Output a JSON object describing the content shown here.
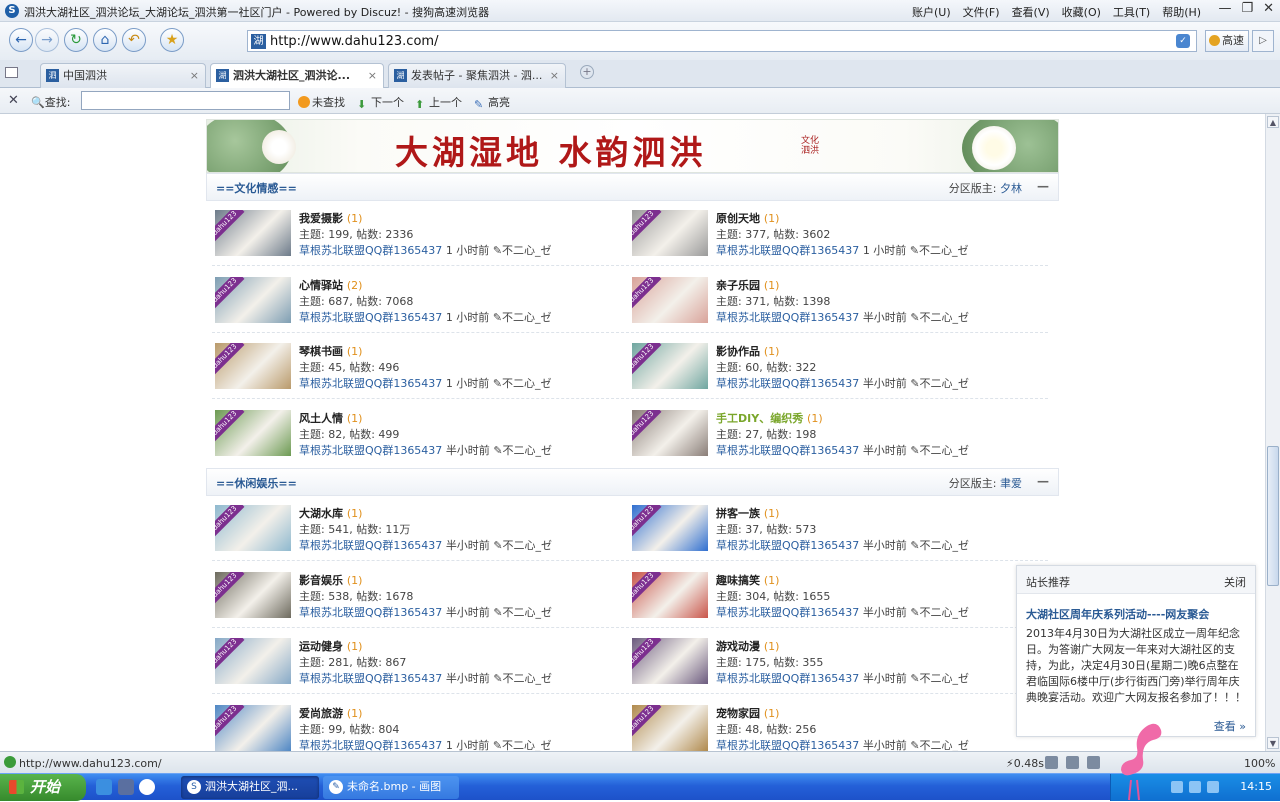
{
  "window": {
    "title": "泗洪大湖社区_泗洪论坛_大湖论坛_泗洪第一社区门户 - Powered by Discuz! - 搜狗高速浏览器",
    "menus": [
      "账户(U)",
      "文件(F)",
      "查看(V)",
      "收藏(O)",
      "工具(T)",
      "帮助(H)"
    ],
    "min": "—",
    "max": "❐",
    "close": "✕"
  },
  "navbar": {
    "url": "http://www.dahu123.com/",
    "speed_label": "高速",
    "back_icon": "arrow-left",
    "forward_icon": "arrow-right",
    "refresh_icon": "refresh",
    "home_icon": "home",
    "undo_icon": "undo",
    "favorite_icon": "star"
  },
  "tabs": [
    {
      "label": "中国泗洪",
      "active": false
    },
    {
      "label": "泗洪大湖社区_泗洪论...",
      "active": true
    },
    {
      "label": "发表帖子 - 聚焦泗洪 - 泗...",
      "active": false
    }
  ],
  "findbar": {
    "close": "✕",
    "label": "查找:",
    "value": "",
    "not_found": "未查找",
    "next": "下一个",
    "prev": "上一个",
    "highlight": "高亮"
  },
  "banner": {
    "text": "大湖湿地  水韵泗洪",
    "seal": "文化泗洪"
  },
  "categories": [
    {
      "name": "==文化情感==",
      "moderator_label": "分区版主:",
      "moderator": "夕林",
      "collapse": "—",
      "forums": [
        {
          "name": "我爱摄影",
          "today": "(1)",
          "stats": "主题: 199, 帖数: 2336",
          "last_title": "草根苏北联盟QQ群1365437",
          "last_time": "1 小时前",
          "last_user": "✎不二心_ゼ",
          "color": "#6d7b8a"
        },
        {
          "name": "原创天地",
          "today": "(1)",
          "stats": "主题: 377, 帖数: 3602",
          "last_title": "草根苏北联盟QQ群1365437",
          "last_time": "1 小时前",
          "last_user": "✎不二心_ゼ",
          "color": "#9a9a9a"
        },
        {
          "name": "心情驿站",
          "today": "(2)",
          "stats": "主题: 687, 帖数: 7068",
          "last_title": "草根苏北联盟QQ群1365437",
          "last_time": "1 小时前",
          "last_user": "✎不二心_ゼ",
          "color": "#7e9eb3"
        },
        {
          "name": "亲子乐园",
          "today": "(1)",
          "stats": "主题: 371, 帖数: 1398",
          "last_title": "草根苏北联盟QQ群1365437",
          "last_time": "半小时前",
          "last_user": "✎不二心_ゼ",
          "color": "#d9a39a"
        },
        {
          "name": "琴棋书画",
          "today": "(1)",
          "stats": "主题: 45, 帖数: 496",
          "last_title": "草根苏北联盟QQ群1365437",
          "last_time": "1 小时前",
          "last_user": "✎不二心_ゼ",
          "color": "#b99a6b"
        },
        {
          "name": "影协作品",
          "today": "(1)",
          "stats": "主题: 60, 帖数: 322",
          "last_title": "草根苏北联盟QQ群1365437",
          "last_time": "半小时前",
          "last_user": "✎不二心_ゼ",
          "color": "#6fa6a0"
        },
        {
          "name": "风土人情",
          "today": "(1)",
          "stats": "主题: 82, 帖数: 499",
          "last_title": "草根苏北联盟QQ群1365437",
          "last_time": "半小时前",
          "last_user": "✎不二心_ゼ",
          "color": "#6c9a52"
        },
        {
          "name": "手工DIY、编织秀",
          "today": "(1)",
          "stats": "主题: 27, 帖数: 198",
          "last_title": "草根苏北联盟QQ群1365437",
          "last_time": "半小时前",
          "last_user": "✎不二心_ゼ",
          "color": "#8a7e78",
          "green": true
        }
      ]
    },
    {
      "name": "==休闲娱乐==",
      "moderator_label": "分区版主:",
      "moderator": "聿爱",
      "collapse": "—",
      "forums": [
        {
          "name": "大湖水库",
          "today": "(1)",
          "stats": "主题: 541, 帖数: 11万",
          "last_title": "草根苏北联盟QQ群1365437",
          "last_time": "半小时前",
          "last_user": "✎不二心_ゼ",
          "color": "#8fb9cf"
        },
        {
          "name": "拼客一族",
          "today": "(1)",
          "stats": "主题: 37, 帖数: 573",
          "last_title": "草根苏北联盟QQ群1365437",
          "last_time": "半小时前",
          "last_user": "✎不二心_ゼ",
          "color": "#2f6fd0"
        },
        {
          "name": "影音娱乐",
          "today": "(1)",
          "stats": "主题: 538, 帖数: 1678",
          "last_title": "草根苏北联盟QQ群1365437",
          "last_time": "半小时前",
          "last_user": "✎不二心_ゼ",
          "color": "#6d6a5e"
        },
        {
          "name": "趣味搞笑",
          "today": "(1)",
          "stats": "主题: 304, 帖数: 1655",
          "last_title": "草根苏北联盟QQ群1365437",
          "last_time": "半小时前",
          "last_user": "✎不二心_ゼ",
          "color": "#c9554a"
        },
        {
          "name": "运动健身",
          "today": "(1)",
          "stats": "主题: 281, 帖数: 867",
          "last_title": "草根苏北联盟QQ群1365437",
          "last_time": "半小时前",
          "last_user": "✎不二心_ゼ",
          "color": "#86a9c7"
        },
        {
          "name": "游戏动漫",
          "today": "(1)",
          "stats": "主题: 175, 帖数: 355",
          "last_title": "草根苏北联盟QQ群1365437",
          "last_time": "半小时前",
          "last_user": "✎不二心_ゼ",
          "color": "#6b5a7e"
        },
        {
          "name": "爱尚旅游",
          "today": "(1)",
          "stats": "主题: 99, 帖数: 804",
          "last_title": "草根苏北联盟QQ群1365437",
          "last_time": "1 小时前",
          "last_user": "✎不二心_ゼ",
          "color": "#4f87c4"
        },
        {
          "name": "宠物家园",
          "today": "(1)",
          "stats": "主题: 48, 帖数: 256",
          "last_title": "草根苏北联盟QQ群1365437",
          "last_time": "半小时前",
          "last_user": "✎不二心_ゼ",
          "color": "#b08a4d"
        }
      ]
    }
  ],
  "popup": {
    "title": "站长推荐",
    "close": "关闭",
    "link": "大湖社区周年庆系列活动----网友聚会",
    "body": "2013年4月30日为大湖社区成立一周年纪念日。为答谢广大网友一年来对大湖社区的支持，为此，决定4月30日(星期二)晚6点整在君临国际6楼中厅(步行街西门旁)举行周年庆典晚宴活动。欢迎广大网友报名参加了！！！",
    "more": "查看 »"
  },
  "statusbar": {
    "url": "http://www.dahu123.com/",
    "time": "0.48s",
    "zoom": "100%"
  },
  "taskbar": {
    "start": "开始",
    "tasks": [
      "泗洪大湖社区_泗...",
      "未命名.bmp - 画图"
    ],
    "clock": "14:15"
  },
  "ribbon_text": "dahu123"
}
